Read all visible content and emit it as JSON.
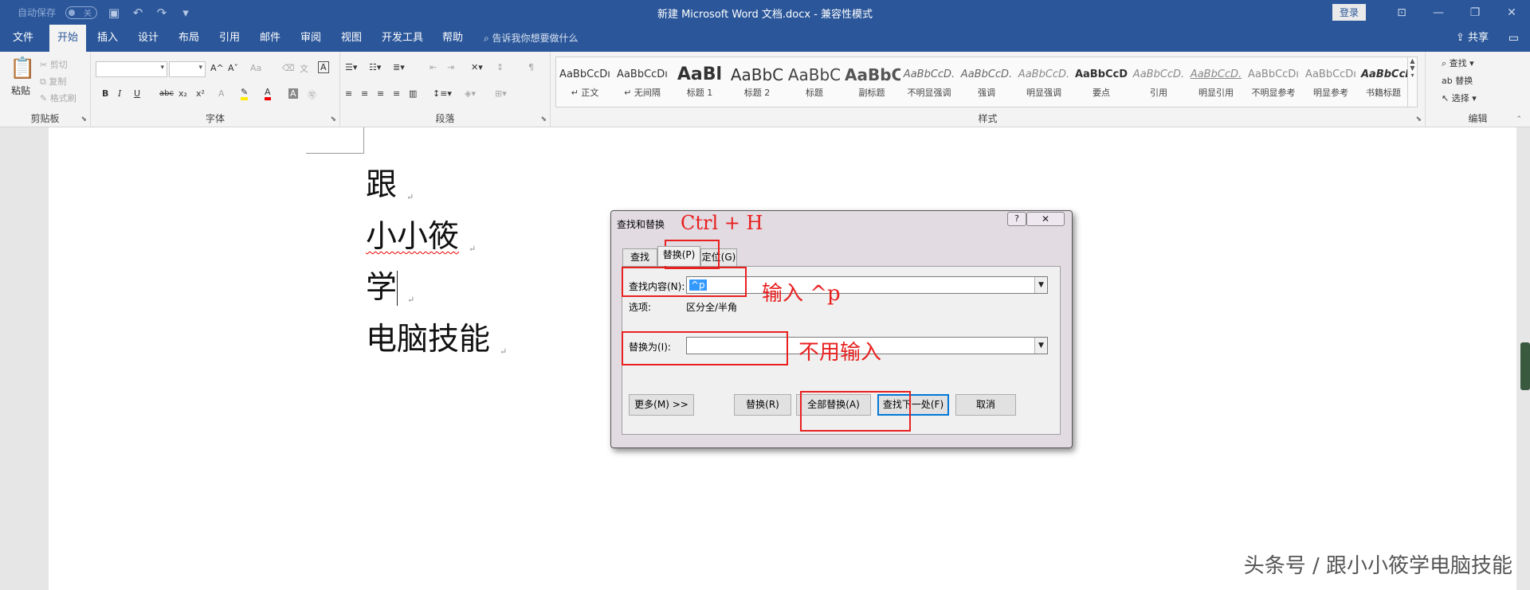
{
  "titlebar": {
    "autosave_label": "自动保存",
    "autosave_state": "关",
    "doc_title": "新建 Microsoft Word 文档.docx  -  兼容性模式",
    "login_label": "登录"
  },
  "tabs": [
    "文件",
    "开始",
    "插入",
    "设计",
    "布局",
    "引用",
    "邮件",
    "审阅",
    "视图",
    "开发工具",
    "帮助"
  ],
  "active_tab": "开始",
  "tell_me": "告诉我你想要做什么",
  "share_label": "共享",
  "ribbon": {
    "clipboard": {
      "label": "剪贴板",
      "paste": "粘贴",
      "cut": "剪切",
      "copy": "复制",
      "format_painter": "格式刷"
    },
    "font": {
      "label": "字体",
      "bold": "B",
      "italic": "I",
      "underline": "U",
      "strike": "abc",
      "sub": "x₂",
      "sup": "x²",
      "grow": "A^",
      "shrink": "Aˇ",
      "case": "Aa"
    },
    "paragraph": {
      "label": "段落"
    },
    "styles": {
      "label": "样式",
      "items": [
        {
          "preview": "AaBbCcDı",
          "name": "↵ 正文"
        },
        {
          "preview": "AaBbCcDı",
          "name": "↵ 无间隔"
        },
        {
          "preview": "AaBl",
          "name": "标题 1"
        },
        {
          "preview": "AaBbC",
          "name": "标题 2"
        },
        {
          "preview": "AaBbC",
          "name": "标题"
        },
        {
          "preview": "AaBbC",
          "name": "副标题"
        },
        {
          "preview": "AaBbCcD.",
          "name": "不明显强调"
        },
        {
          "preview": "AaBbCcD.",
          "name": "强调"
        },
        {
          "preview": "AaBbCcD.",
          "name": "明显强调"
        },
        {
          "preview": "AaBbCcD",
          "name": "要点"
        },
        {
          "preview": "AaBbCcD.",
          "name": "引用"
        },
        {
          "preview": "AaBbCcD.",
          "name": "明显引用"
        },
        {
          "preview": "AaBbCcDı",
          "name": "不明显参考"
        },
        {
          "preview": "AaBbCcDı",
          "name": "明显参考"
        },
        {
          "preview": "AaBbCcD",
          "name": "书籍标题"
        }
      ]
    },
    "editing": {
      "label": "编辑",
      "find": "查找",
      "replace": "替换",
      "select": "选择"
    }
  },
  "document": {
    "lines": [
      "跟",
      "小小筱",
      "学",
      "电脑技能"
    ]
  },
  "dialog": {
    "title": "查找和替换",
    "help": "?",
    "close": "✕",
    "tabs": [
      "查找(D)",
      "替换(P)",
      "定位(G)"
    ],
    "find_label": "查找内容(N):",
    "find_value": "^p",
    "options_label": "选项:",
    "options_value": "区分全/半角",
    "replace_label": "替换为(I):",
    "replace_value": "",
    "buttons": {
      "more": "更多(M) >>",
      "replace": "替换(R)",
      "replace_all": "全部替换(A)",
      "find_next": "查找下一处(F)",
      "cancel": "取消"
    }
  },
  "annotations": {
    "shortcut": "Ctrl + H",
    "input_hint": "输入 ^p",
    "no_input": "不用输入"
  },
  "watermark": "头条号 / 跟小小筱学电脑技能",
  "colors": {
    "brand": "#2b579a",
    "annotation": "#e82020",
    "selection": "#3399ff"
  }
}
